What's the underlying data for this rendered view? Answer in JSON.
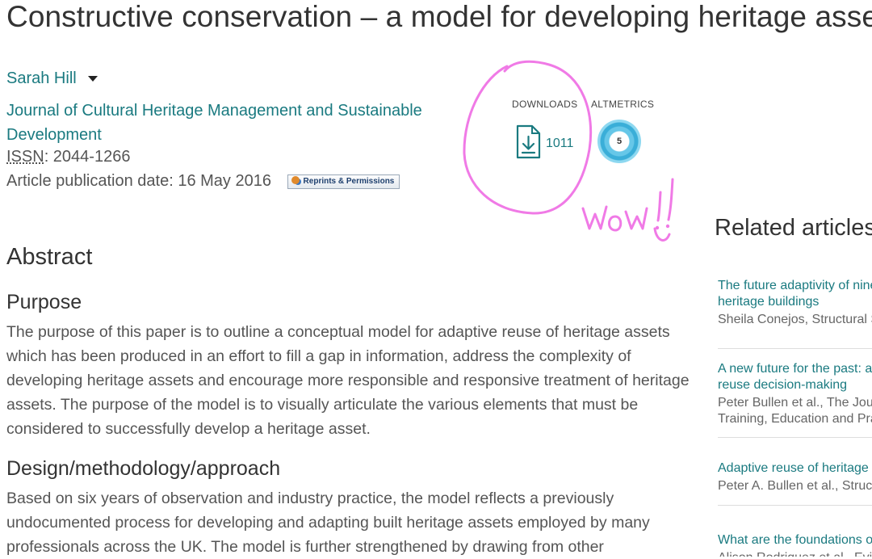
{
  "article": {
    "title": "Constructive conservation – a model for developing heritage assets",
    "author": "Sarah Hill",
    "journal": "Journal of Cultural Heritage Management and Sustainable Development",
    "issn_label": "ISSN",
    "issn_value": ": 2044-1266",
    "pub_date": "Article publication date: 16 May 2016",
    "reprints_label": "Reprints & Permissions"
  },
  "metrics": {
    "downloads_label": "DOWNLOADS",
    "downloads_count": "1011",
    "altmetrics_label": "ALTMETRICS",
    "altmetric_score": "5"
  },
  "annotation": {
    "text": "Wow !!",
    "color": "#f07ae6"
  },
  "abstract": {
    "heading": "Abstract",
    "sections": [
      {
        "heading": "Purpose",
        "text": "The purpose of this paper is to outline a conceptual model for adaptive reuse of heritage assets which has been produced in an effort to fill a gap in information, address the complexity of developing heritage assets and encourage more responsible and responsive treatment of heritage assets. The purpose of the model is to visually articulate the various elements that must be considered to successfully develop a heritage asset."
      },
      {
        "heading": "Design/methodology/approach",
        "text": "Based on six years of observation and industry practice, the model reflects a previously undocumented process for developing and adapting built heritage assets employed by many professionals across the UK. The model is further strengthened by drawing from other"
      }
    ]
  },
  "related": {
    "heading": "Related articles",
    "items": [
      {
        "title_l1": "The future adaptivity of nine",
        "title_l2": "heritage buildings",
        "authors_l1": "Sheila Conejos, Structural S",
        "authors_l2": ""
      },
      {
        "title_l1": "A new future for the past: a",
        "title_l2": "reuse decision-making",
        "authors_l1": "Peter Bullen et al., The Jour",
        "authors_l2": "Training, Education and Pra"
      },
      {
        "title_l1": "Adaptive reuse of heritage b",
        "title_l2": "",
        "authors_l1": "Peter A. Bullen et al., Struct",
        "authors_l2": ""
      },
      {
        "title_l1": "What are the foundations o",
        "title_l2": "",
        "authors_l1": "Alison Rodriguez et al., Evid",
        "authors_l2": ""
      }
    ]
  },
  "colors": {
    "link": "#1a7a80",
    "text": "#333333",
    "muted": "#555555"
  }
}
